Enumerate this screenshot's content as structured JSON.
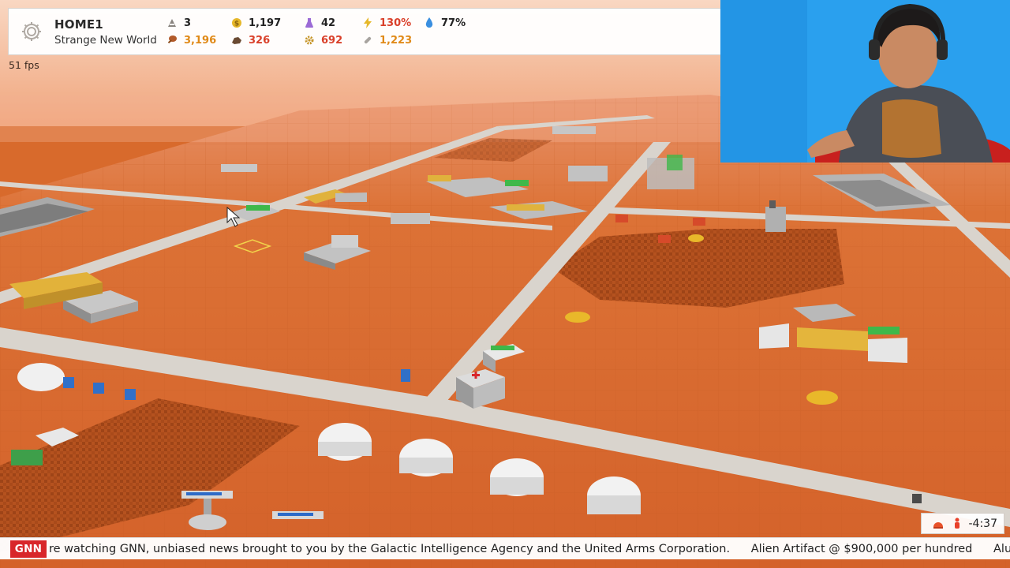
{
  "hud": {
    "base_name": "HOME1",
    "world_name": "Strange New World",
    "resources_top": [
      {
        "icon": "worker-icon",
        "value": "3",
        "status": "normal"
      },
      {
        "icon": "money-coin-icon",
        "value": "1,197",
        "status": "normal"
      },
      {
        "icon": "research-flask-icon",
        "value": "42",
        "status": "normal"
      },
      {
        "icon": "power-bolt-icon",
        "value": "130%",
        "status": "bad"
      },
      {
        "icon": "water-drop-icon",
        "value": "77%",
        "status": "normal"
      }
    ],
    "resources_bottom": [
      {
        "icon": "food-icon",
        "value": "3,196",
        "status": "warn"
      },
      {
        "icon": "ore-icon",
        "value": "326",
        "status": "bad"
      },
      {
        "icon": "gear-parts-icon",
        "value": "692",
        "status": "bad"
      },
      {
        "icon": "alloy-icon",
        "value": "1,223",
        "status": "warn"
      }
    ]
  },
  "fps_text": "51 fps",
  "timer": {
    "value": "-4:37",
    "icons": [
      "colony-alert-icon",
      "person-alert-icon"
    ]
  },
  "ticker": {
    "logo": "GNN",
    "messages": [
      "re watching GNN, unbiased news brought to you by the Galactic Intelligence Agency and the United Arms Corporation.",
      "Alien Artifact @ $900,000 per hundred",
      "Alumin"
    ]
  },
  "colors": {
    "ground": "#d86a2c",
    "road": "#d9d4cd",
    "sky": "#f6c4a6",
    "tilled": "#b3511f",
    "news_red": "#d8262a",
    "status_bad": "#d9402a",
    "status_warn": "#e08a18"
  }
}
